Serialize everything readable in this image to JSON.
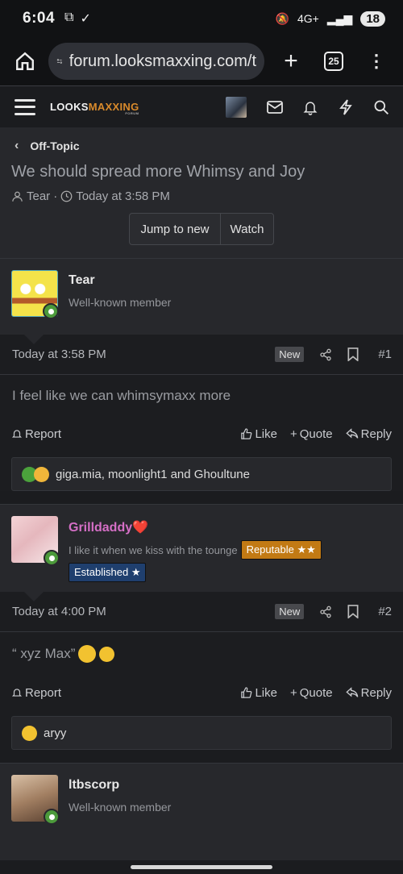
{
  "status": {
    "time": "6:04",
    "signal": "4G+",
    "battery": "18"
  },
  "browser": {
    "url": "forum.looksmaxxing.com/t",
    "tabs_count": "25"
  },
  "site": {
    "logo_main": "LOOKS",
    "logo_accent": "MAXXING",
    "logo_sub": "FORUM"
  },
  "thread": {
    "breadcrumb": "Off-Topic",
    "title": "We should spread more Whimsy and Joy",
    "author": "Tear",
    "sep": "·",
    "time": "Today at 3:58 PM",
    "jump_label": "Jump to new",
    "watch_label": "Watch"
  },
  "posts": [
    {
      "username": "Tear",
      "user_title": "Well-known member",
      "date": "Today at 3:58 PM",
      "badge": "New",
      "number": "#1",
      "body": "I feel like we can whimsymaxx more",
      "report": "Report",
      "like": "Like",
      "quote": "Quote",
      "reply": "Reply",
      "reactions_text": "giga.mia, moonlight1 and Ghoultune"
    },
    {
      "username": "Grilldaddy",
      "username_heart": "❤️",
      "user_title": "I like it when we kiss with the tounge",
      "banner_reputable": "Reputable ★★",
      "banner_established": "Established ★",
      "date": "Today at 4:00 PM",
      "badge": "New",
      "number": "#2",
      "body": "“ xyz Max”",
      "report": "Report",
      "like": "Like",
      "quote": "Quote",
      "reply": "Reply",
      "reactions_text": "aryy"
    },
    {
      "username": "ltbscorp",
      "user_title": "Well-known member"
    }
  ],
  "colors": {
    "accent": "#d98a2b",
    "grill_name": "#d56fc6",
    "reputable": "#c27a14",
    "established": "#1f3f6e"
  }
}
